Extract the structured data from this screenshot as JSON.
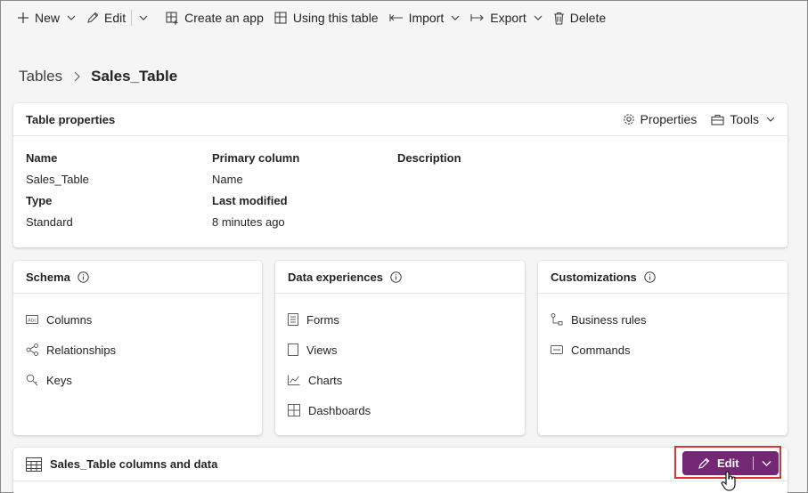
{
  "command_bar": {
    "new_label": "New",
    "edit_label": "Edit",
    "create_app_label": "Create an app",
    "using_table_label": "Using this table",
    "import_label": "Import",
    "export_label": "Export",
    "delete_label": "Delete"
  },
  "breadcrumb": {
    "parent": "Tables",
    "current": "Sales_Table"
  },
  "table_properties": {
    "title": "Table properties",
    "properties_label": "Properties",
    "tools_label": "Tools",
    "name_label": "Name",
    "name_value": "Sales_Table",
    "type_label": "Type",
    "type_value": "Standard",
    "primary_column_label": "Primary column",
    "primary_column_value": "Name",
    "last_modified_label": "Last modified",
    "last_modified_value": "8 minutes ago",
    "description_label": "Description"
  },
  "schema": {
    "title": "Schema",
    "items": [
      {
        "label": "Columns",
        "icon": "columns-icon"
      },
      {
        "label": "Relationships",
        "icon": "relationships-icon"
      },
      {
        "label": "Keys",
        "icon": "key-icon"
      }
    ]
  },
  "data_experiences": {
    "title": "Data experiences",
    "items": [
      {
        "label": "Forms",
        "icon": "form-icon"
      },
      {
        "label": "Views",
        "icon": "view-icon"
      },
      {
        "label": "Charts",
        "icon": "chart-icon"
      },
      {
        "label": "Dashboards",
        "icon": "dashboard-icon"
      }
    ]
  },
  "customizations": {
    "title": "Customizations",
    "items": [
      {
        "label": "Business rules",
        "icon": "business-rules-icon"
      },
      {
        "label": "Commands",
        "icon": "commands-icon"
      }
    ]
  },
  "columns_data": {
    "title": "Sales_Table columns and data",
    "edit_label": "Edit"
  },
  "colors": {
    "accent": "#742774",
    "highlight": "#e0303a",
    "background": "#f5f5f5"
  }
}
